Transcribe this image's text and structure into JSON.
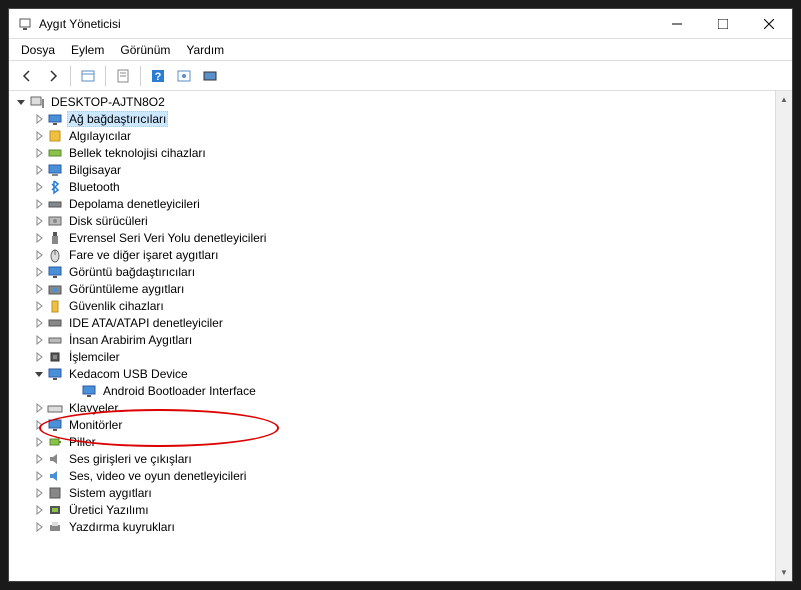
{
  "window": {
    "title": "Aygıt Yöneticisi"
  },
  "menu": {
    "file": "Dosya",
    "action": "Eylem",
    "view": "Görünüm",
    "help": "Yardım"
  },
  "tree": {
    "root": "DESKTOP-AJTN8O2",
    "items": [
      {
        "label": "Ağ bağdaştırıcıları",
        "icon": "network",
        "selected": true
      },
      {
        "label": "Algılayıcılar",
        "icon": "sensor"
      },
      {
        "label": "Bellek teknolojisi cihazları",
        "icon": "memory"
      },
      {
        "label": "Bilgisayar",
        "icon": "computer"
      },
      {
        "label": "Bluetooth",
        "icon": "bluetooth"
      },
      {
        "label": "Depolama denetleyicileri",
        "icon": "storage"
      },
      {
        "label": "Disk sürücüleri",
        "icon": "disk"
      },
      {
        "label": "Evrensel Seri Veri Yolu denetleyicileri",
        "icon": "usb"
      },
      {
        "label": "Fare ve diğer işaret aygıtları",
        "icon": "mouse"
      },
      {
        "label": "Görüntü bağdaştırıcıları",
        "icon": "display"
      },
      {
        "label": "Görüntüleme aygıtları",
        "icon": "camera"
      },
      {
        "label": "Güvenlik cihazları",
        "icon": "security"
      },
      {
        "label": "IDE ATA/ATAPI denetleyiciler",
        "icon": "ide"
      },
      {
        "label": "İnsan Arabirim Aygıtları",
        "icon": "hid"
      },
      {
        "label": "İşlemciler",
        "icon": "cpu"
      },
      {
        "label": "Kedacom USB Device",
        "icon": "monitor",
        "expanded": true,
        "children": [
          {
            "label": "Android Bootloader Interface",
            "icon": "monitor"
          }
        ]
      },
      {
        "label": "Klavyeler",
        "icon": "keyboard"
      },
      {
        "label": "Monitörler",
        "icon": "monitor"
      },
      {
        "label": "Piller",
        "icon": "battery"
      },
      {
        "label": "Ses girişleri ve çıkışları",
        "icon": "audio"
      },
      {
        "label": "Ses, video ve oyun denetleyicileri",
        "icon": "sound"
      },
      {
        "label": "Sistem aygıtları",
        "icon": "system"
      },
      {
        "label": "Üretici Yazılımı",
        "icon": "firmware"
      },
      {
        "label": "Yazdırma kuyrukları",
        "icon": "print"
      }
    ]
  }
}
